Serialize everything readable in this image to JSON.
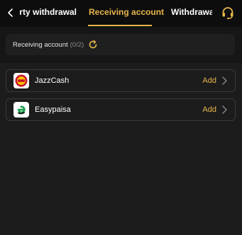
{
  "header": {
    "tabs": [
      {
        "label": "Third-party withdrawal"
      },
      {
        "label": "Receiving account"
      },
      {
        "label": "Withdrawal history"
      }
    ],
    "active_tab": 1,
    "accent_color": "#e8b64a"
  },
  "banner": {
    "label": "Receiving account",
    "count": "(0/2)"
  },
  "accounts": [
    {
      "name": "JazzCash",
      "action": "Add",
      "icon": "jazzcash-logo"
    },
    {
      "name": "Easypaisa",
      "action": "Add",
      "icon": "easypaisa-logo"
    }
  ]
}
